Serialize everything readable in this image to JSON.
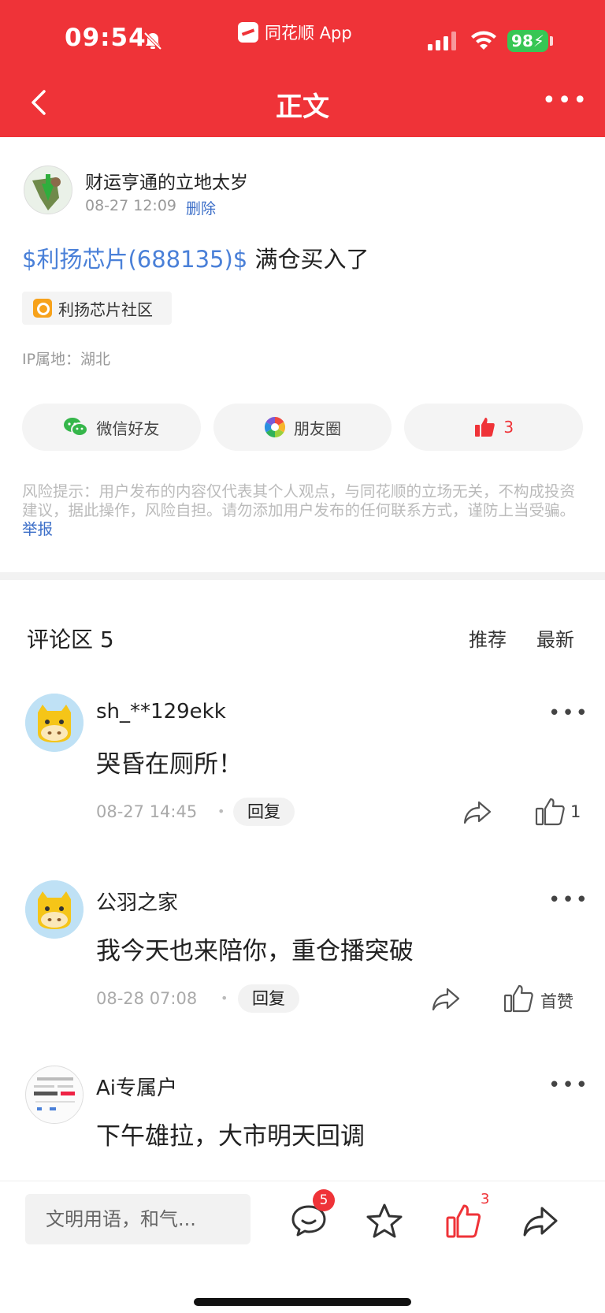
{
  "status_bar": {
    "time": "09:54",
    "app_name": "同花顺 App",
    "battery": "98"
  },
  "header": {
    "title": "正文"
  },
  "post": {
    "author": "财运亨通的立地太岁",
    "time": "08-27 12:09",
    "delete_label": "删除",
    "stock_link": "$利扬芯片(688135)$",
    "text": " 满仓买入了",
    "community_tag": "利扬芯片社区",
    "ip_location": "IP属地：湖北"
  },
  "share": {
    "wechat_label": "微信好友",
    "moments_label": "朋友圈",
    "like_count": "3"
  },
  "disclaimer": {
    "text": "风险提示：用户发布的内容仅代表其个人观点，与同花顺的立场无关，不构成投资建议，据此操作，风险自担。请勿添加用户发布的任何联系方式，谨防上当受骗。",
    "report_label": "举报"
  },
  "comments": {
    "title": "评论区 5",
    "sort_recommend": "推荐",
    "sort_latest": "最新",
    "reply_label": "回复",
    "items": [
      {
        "name": "sh_**129ekk",
        "text": "哭昏在厕所！",
        "time": "08-27 14:45",
        "likes": "1"
      },
      {
        "name": "公羽之家",
        "text": "我今天也来陪你，重仓播突破",
        "time": "08-28 07:08",
        "likes": "首赞"
      },
      {
        "name": "Ai专属户",
        "text": "下午雄拉，大市明天回调",
        "time": "",
        "likes": ""
      }
    ]
  },
  "bottom_bar": {
    "input_placeholder": "文明用语，和气...",
    "comment_badge": "5",
    "like_count": "3"
  },
  "colors": {
    "brand_red": "#ef3338",
    "link_blue": "#4a80d8"
  }
}
